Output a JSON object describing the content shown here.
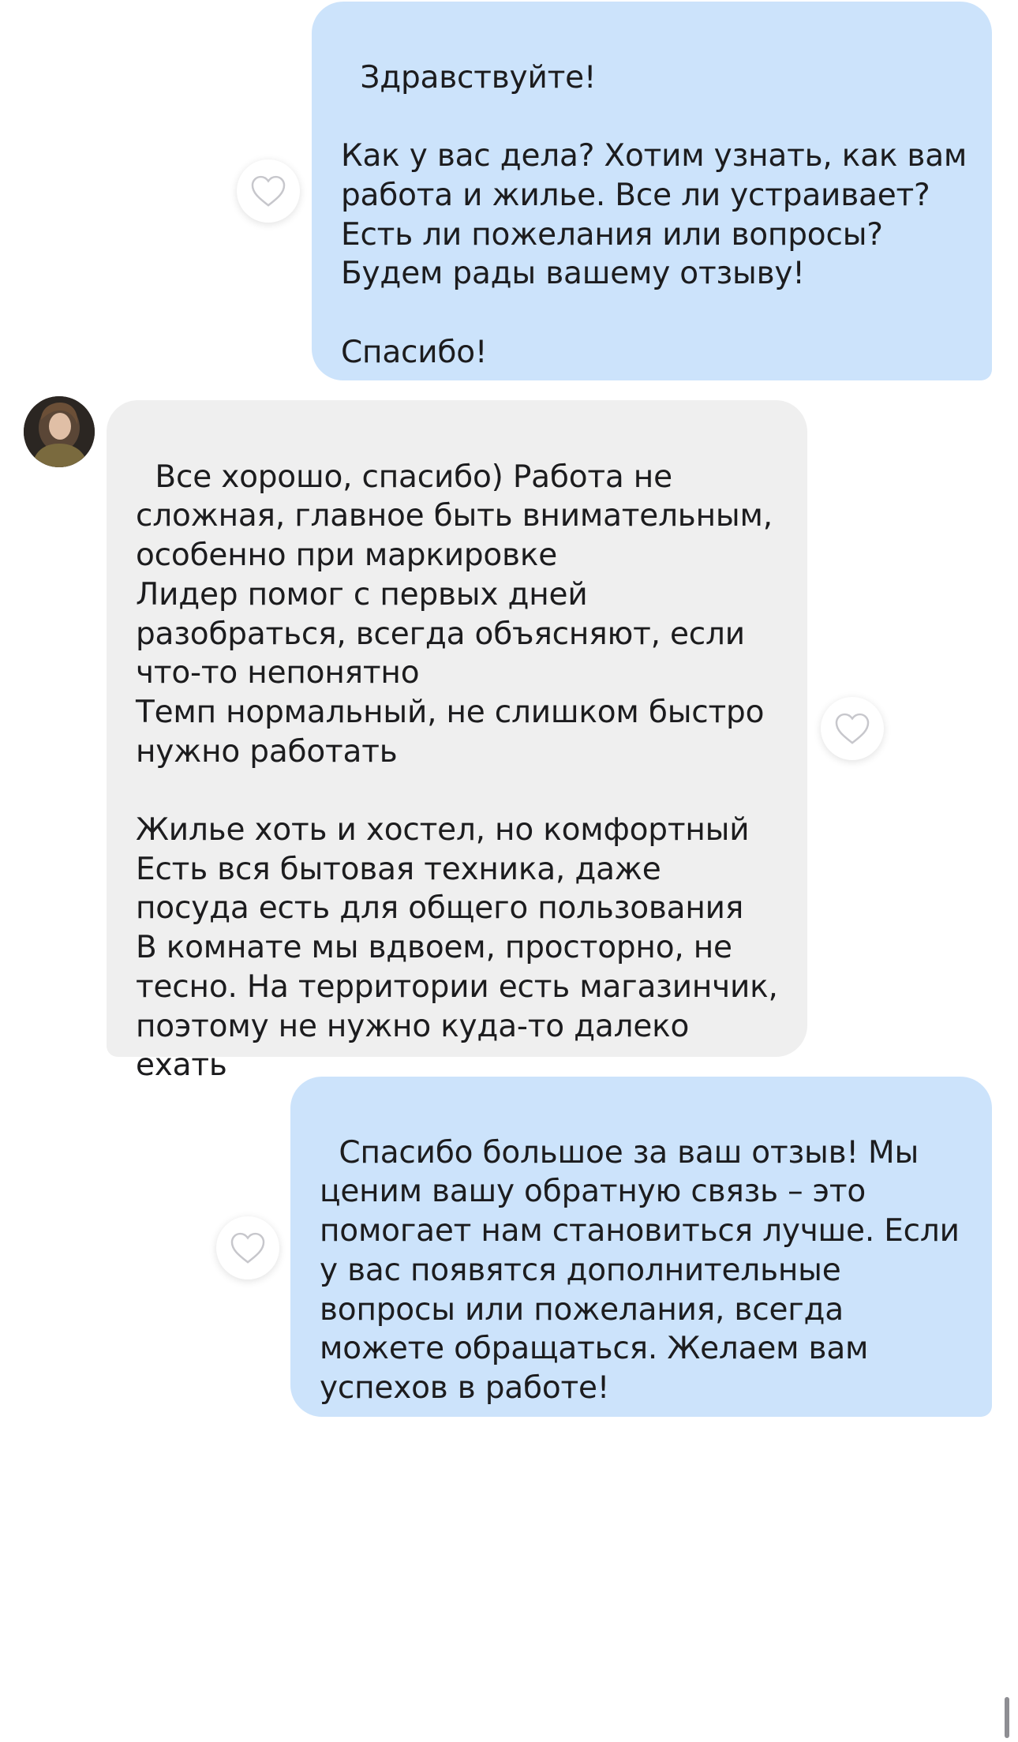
{
  "chat": {
    "messages": [
      {
        "sender": "outgoing",
        "text": "Здравствуйте!\n\nКак у вас дела? Хотим узнать, как вам работа и жилье. Все ли устраивает? Есть ли пожелания или вопросы? Будем рады вашему отзыву!\n\nСпасибо!"
      },
      {
        "sender": "incoming",
        "text": "Все хорошо, спасибо) Работа не сложная, главное быть внимательным, особенно при маркировке\nЛидер помог с первых дней разобраться, всегда объясняют, если что-то непонятно\nТемп нормальный, не слишком быстро нужно работать\n\nЖилье хоть и хостел, но комфортный\nЕсть вся бытовая техника, даже посуда есть для общего пользования\nВ комнате мы вдвоем, просторно, не тесно. На территории есть магазинчик, поэтому не нужно куда-то далеко ехать"
      },
      {
        "sender": "outgoing",
        "text": "Спасибо большое за ваш отзыв! Мы ценим вашу обратную связь – это помогает нам становиться лучше. Если у вас появятся дополнительные вопросы или пожелания, всегда можете обращаться. Желаем вам успехов в работе!"
      }
    ],
    "reaction_icon": "heart-outline-icon"
  },
  "colors": {
    "outgoing_bubble": "#cce3fb",
    "incoming_bubble": "#efefef",
    "text": "#1c1c1e",
    "heart_stroke": "#c7c7cc"
  }
}
